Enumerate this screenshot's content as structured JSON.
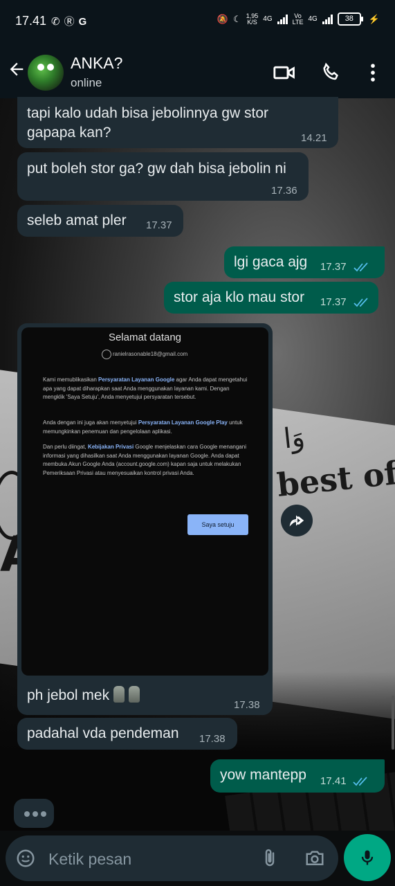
{
  "status_bar": {
    "time": "17.41",
    "notif_icons": [
      "whatsapp-icon",
      "b-icon",
      "google-g-icon"
    ],
    "net_speed_value": "1,95",
    "net_speed_unit": "K/S",
    "network1": "4G",
    "volte_top": "Vo",
    "volte_bottom": "LTE",
    "network2": "4G",
    "battery": "38"
  },
  "header": {
    "contact_name": "ANKA?",
    "status": "online"
  },
  "messages": [
    {
      "dir": "in",
      "text1": "tapi kalo udah bisa jebolinnya gw stor",
      "text2": "gapapa kan?",
      "time": "14.21"
    },
    {
      "dir": "in",
      "text": "put boleh stor ga? gw dah bisa jebolin ni",
      "time": "17.36"
    },
    {
      "dir": "in",
      "text": "seleb amat pler",
      "time": "17.37"
    },
    {
      "dir": "out",
      "text": "lgi gaca ajg",
      "time": "17.37"
    },
    {
      "dir": "out",
      "text": "stor aja klo mau stor",
      "time": "17.37"
    },
    {
      "dir": "in",
      "type": "image",
      "caption": "ph jebol mek",
      "time": "17.38"
    },
    {
      "dir": "in",
      "text": "padahal vda pendeman",
      "time": "17.38"
    },
    {
      "dir": "out",
      "text": "yow mantepp",
      "time": "17.41"
    }
  ],
  "image_content": {
    "title": "Selamat datang",
    "email": "ranielrasonable18@gmail.com",
    "p1_a": "Kami memublikasikan ",
    "p1_link": "Persyaratan Layanan Google",
    "p1_b": " agar Anda dapat mengetahui apa yang dapat diharapkan saat Anda menggunakan layanan kami. Dengan mengklik 'Saya Setuju', Anda menyetujui persyaratan tersebut.",
    "p2_a": "Anda dengan ini juga akan menyetujui ",
    "p2_link": "Persyaratan Layanan Google Play",
    "p2_b": " untuk memungkinkan penemuan dan pengelolaan aplikasi.",
    "p3_a": "Dan perlu diingat, ",
    "p3_link": "Kebijakan Privasi",
    "p3_b": " Google menjelaskan cara Google menangani informasi yang dihasilkan saat Anda menggunakan layanan Google. Anda dapat membuka Akun Google Anda (account.google.com) kapan saja untuk melakukan Pemeriksaan Privasi atau menyesuaikan kontrol privasi Anda.",
    "button": "Saya setuju"
  },
  "wallpaper": {
    "text": "best of pla",
    "arabic": "وَا",
    "letter": "A"
  },
  "composer": {
    "placeholder": "Ketik pesan"
  },
  "colors": {
    "incoming_bubble": "#1f2c34",
    "outgoing_bubble": "#005c4b",
    "accent": "#00a884",
    "read_ticks": "#53bdeb"
  }
}
